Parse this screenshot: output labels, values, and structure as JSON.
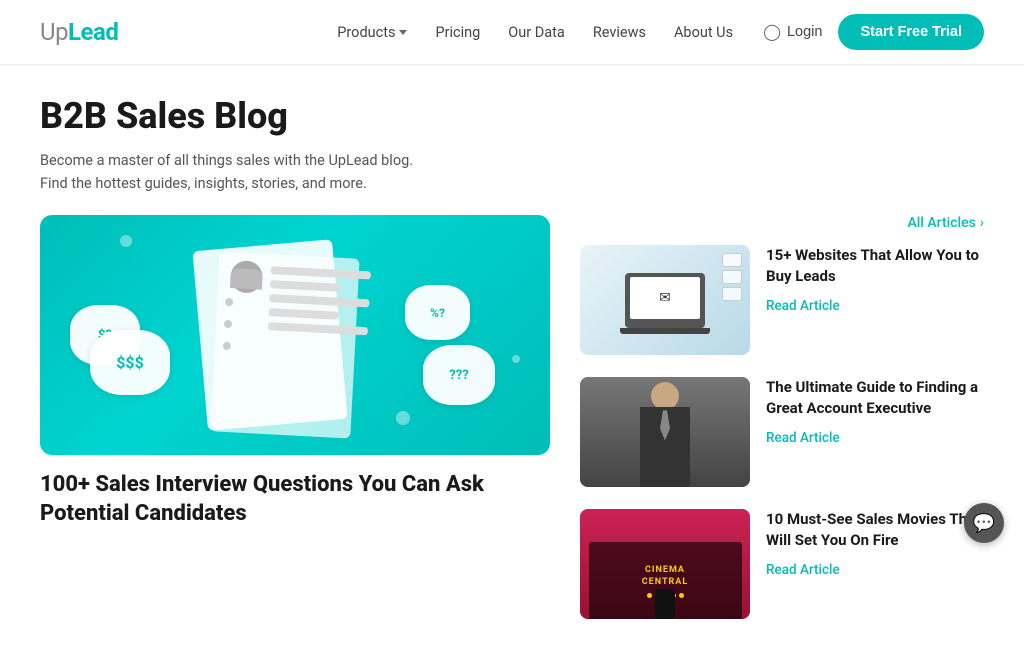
{
  "logo": {
    "up": "Up",
    "lead": "Lead"
  },
  "nav": {
    "items": [
      {
        "label": "Products",
        "hasDropdown": true
      },
      {
        "label": "Pricing",
        "hasDropdown": false
      },
      {
        "label": "Our Data",
        "hasDropdown": false
      },
      {
        "label": "Reviews",
        "hasDropdown": false
      },
      {
        "label": "About Us",
        "hasDropdown": false
      }
    ]
  },
  "header": {
    "login_label": "Login",
    "cta_label": "Start Free Trial"
  },
  "blog": {
    "title": "B2B Sales Blog",
    "subtitle": "Become a master of all things sales with the UpLead blog. Find the hottest guides, insights, stories, and more.",
    "all_articles_label": "All Articles",
    "all_articles_arrow": "›"
  },
  "featured_article": {
    "bubbles": [
      "$?",
      "$$$",
      "%?",
      "???"
    ],
    "title": "100+ Sales Interview Questions You Can Ask Potential Candidates"
  },
  "side_articles": [
    {
      "title": "15+ Websites That Allow You to Buy Leads",
      "read_label": "Read Article"
    },
    {
      "title": "The Ultimate Guide to Finding a Great Account Executive",
      "read_label": "Read Article"
    },
    {
      "title": "10 Must-See Sales Movies That Will Set You On Fire",
      "read_label": "Read Article"
    }
  ]
}
